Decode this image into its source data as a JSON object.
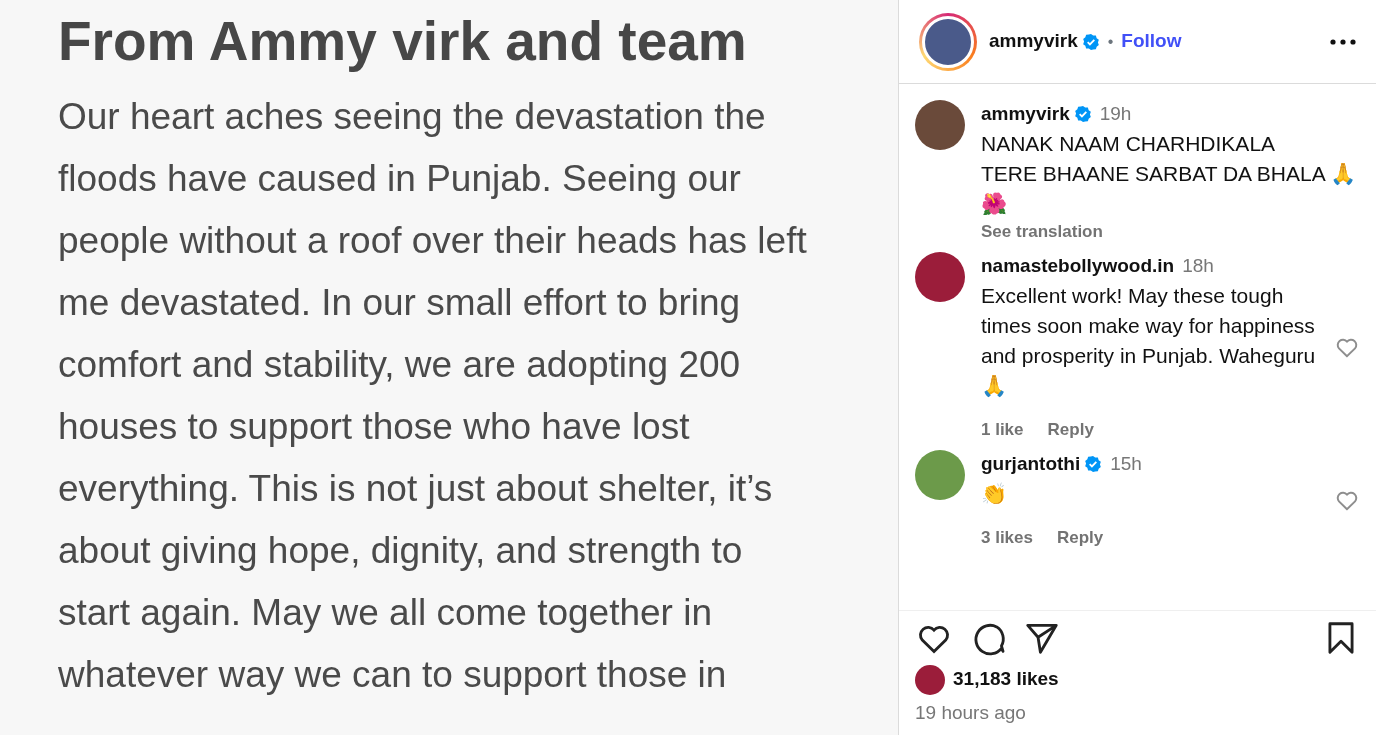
{
  "post_image": {
    "title": "From Ammy virk and team",
    "body": "Our heart aches seeing the devastation the floods have caused in Punjab. Seeing our people without a roof over their heads has left me devastated. In our small effort to bring comfort and stability, we are adopting 200 houses to support those who have lost everything. This is not just about shelter, it’s about giving hope, dignity, and strength to start again. May we all come together in whatever way we can to support those in"
  },
  "header": {
    "username": "ammyvirk",
    "verified": true,
    "separator": "•",
    "follow": "Follow"
  },
  "comments": [
    {
      "username": "ammyvirk",
      "verified": true,
      "time": "19h",
      "text": "NANAK NAAM CHARHDIKALA\nTERE BHAANE SARBAT DA BHALA 🙏\n🌺",
      "translation": "See translation"
    },
    {
      "username": "namastebollywood.in",
      "verified": false,
      "time": "18h",
      "text": "Excellent work! May these tough times soon make way for happiness and prosperity in Punjab. Waheguru 🙏",
      "likes": "1 like",
      "reply": "Reply"
    },
    {
      "username": "gurjantothi",
      "verified": true,
      "time": "15h",
      "text": "👏",
      "likes": "3 likes",
      "reply": "Reply"
    }
  ],
  "likes": "31,183 likes",
  "posted": "19 hours ago"
}
